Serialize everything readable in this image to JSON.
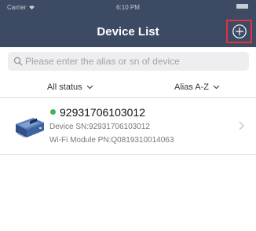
{
  "status_bar": {
    "carrier": "Carrier",
    "time": "6:10 PM"
  },
  "header": {
    "title": "Device List",
    "add_icon": "plus-circle-icon"
  },
  "search": {
    "placeholder": "Please enter the alias or sn of device",
    "value": ""
  },
  "filters": {
    "status_label": "All status",
    "sort_label": "Alias A-Z"
  },
  "devices": [
    {
      "alias": "92931706103012",
      "status": "online",
      "status_color": "#45b449",
      "sn_text": "Device SN:92931706103012",
      "pn_text": "Wi-Fi Module PN:Q0819310014063"
    }
  ],
  "colors": {
    "header_bg": "#3d4a63",
    "highlight": "#e3323e",
    "online": "#45b449"
  }
}
